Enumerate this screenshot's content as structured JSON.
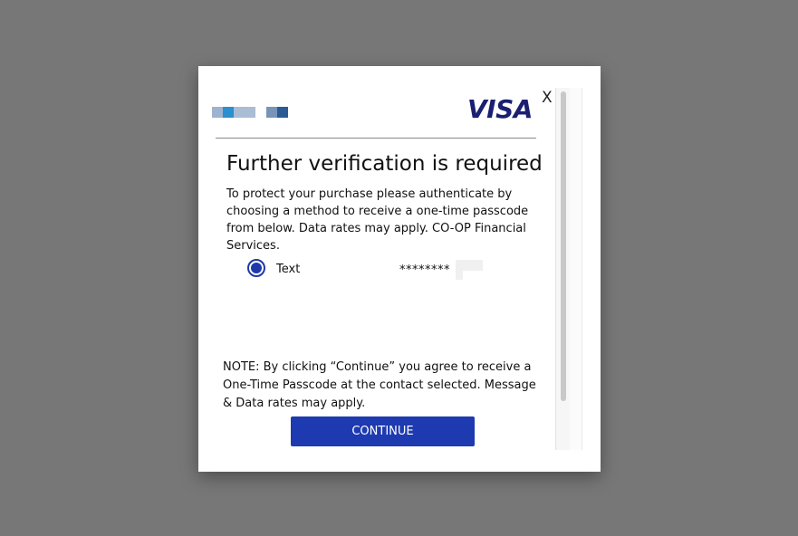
{
  "overlay_color": "#777777",
  "brand": {
    "card_network": "VISA",
    "card_network_color": "#1a1f71"
  },
  "dialog": {
    "close_label": "X",
    "title": "Further verification is required",
    "description": "To protect your purchase please authenticate by choosing a method to receive a one-time passcode from below. Data rates may apply. CO-OP Financial Services.",
    "methods": [
      {
        "label": "Text",
        "masked_value": "********",
        "selected": true
      }
    ],
    "note": "NOTE: By clicking “Continue” you agree to receive a One-Time Passcode at the contact selected. Message & Data rates may apply.",
    "continue_label": "CONTINUE",
    "accent_color": "#1e3ab0"
  }
}
